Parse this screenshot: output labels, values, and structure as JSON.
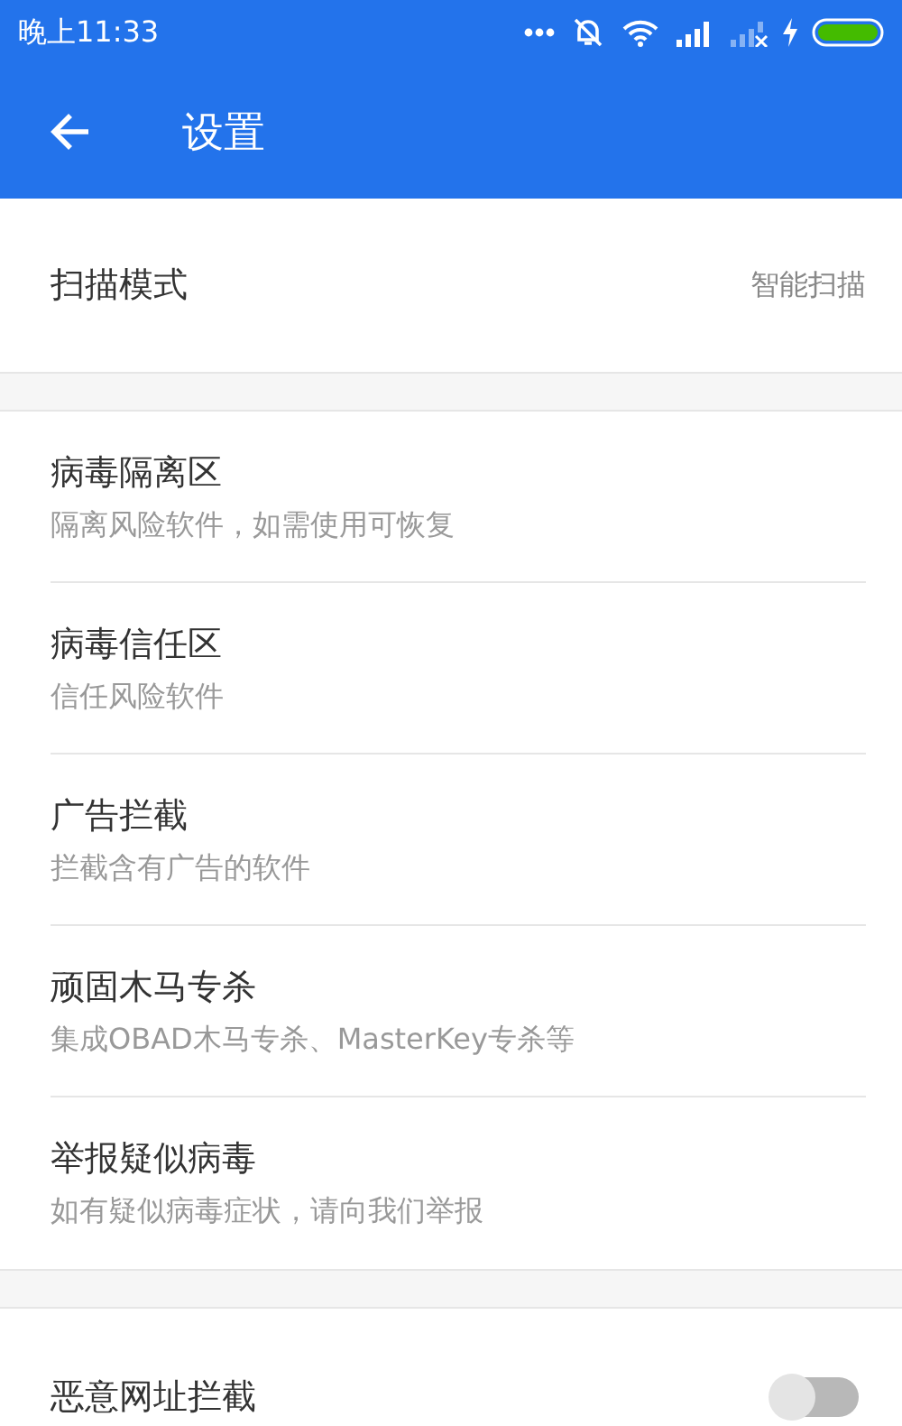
{
  "status_bar": {
    "time": "晚上11:33"
  },
  "app_bar": {
    "title": "设置"
  },
  "scan_mode": {
    "label": "扫描模式",
    "value": "智能扫描"
  },
  "items": [
    {
      "title": "病毒隔离区",
      "subtitle": "隔离风险软件，如需使用可恢复"
    },
    {
      "title": "病毒信任区",
      "subtitle": "信任风险软件"
    },
    {
      "title": "广告拦截",
      "subtitle": "拦截含有广告的软件"
    },
    {
      "title": "顽固木马专杀",
      "subtitle": "集成OBAD木马专杀、MasterKey专杀等"
    },
    {
      "title": "举报疑似病毒",
      "subtitle": "如有疑似病毒症状，请向我们举报"
    }
  ],
  "toggle_items": [
    {
      "title": "恶意网址拦截",
      "on": false
    }
  ]
}
